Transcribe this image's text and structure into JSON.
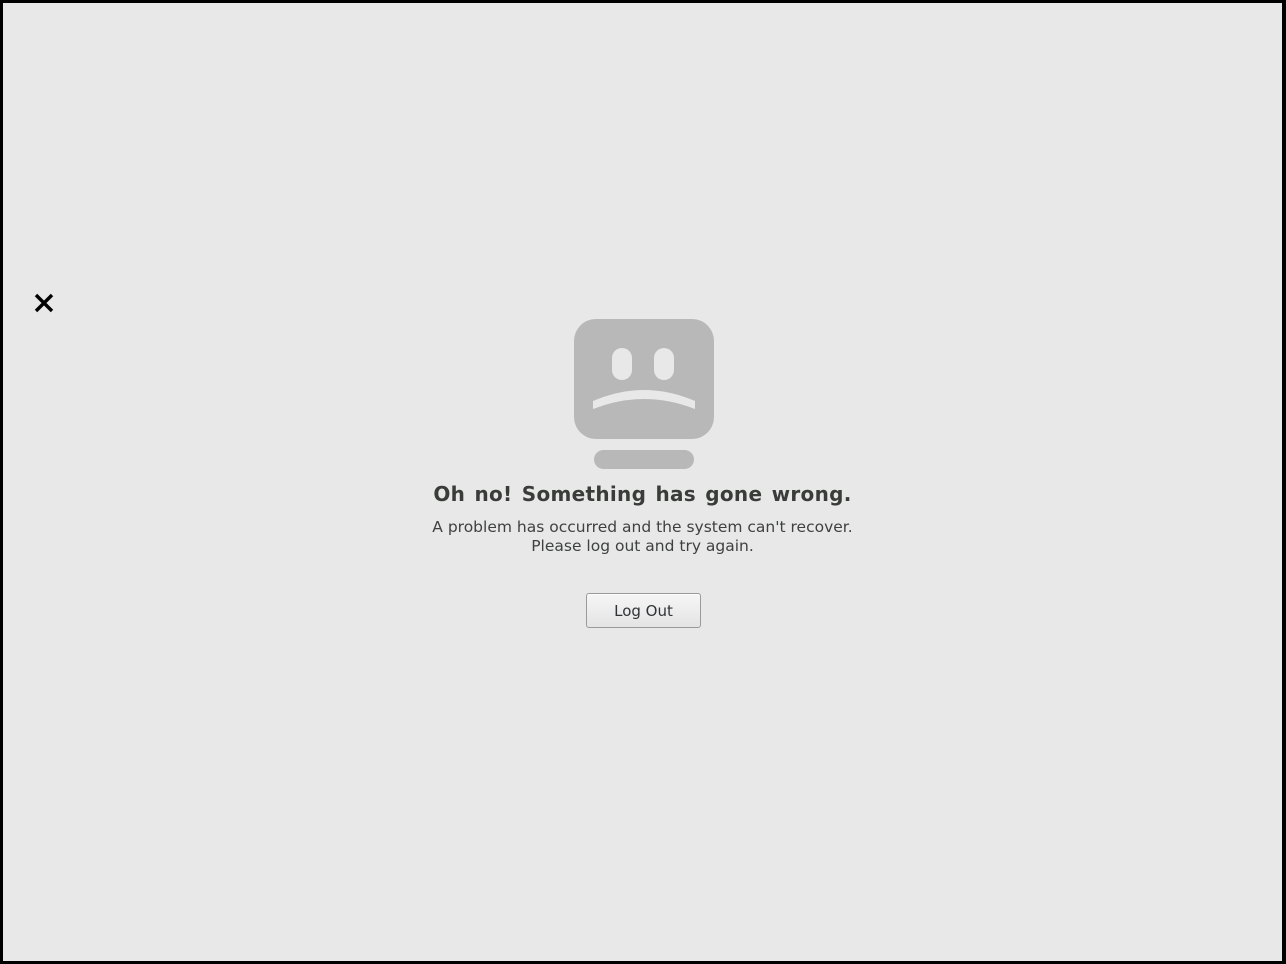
{
  "error_screen": {
    "title": "Oh no!  Something has gone wrong.",
    "message_line_1": "A problem has occurred and the system can't recover.",
    "message_line_2": "Please log out and try again.",
    "logout_label": "Log Out"
  },
  "icons": {
    "close": "close-icon",
    "illustration": "sad-computer-icon"
  },
  "colors": {
    "background": "#e8e8e8",
    "frame": "#000000",
    "illustration": "#b8b8b8",
    "text": "#3a3c3a"
  }
}
